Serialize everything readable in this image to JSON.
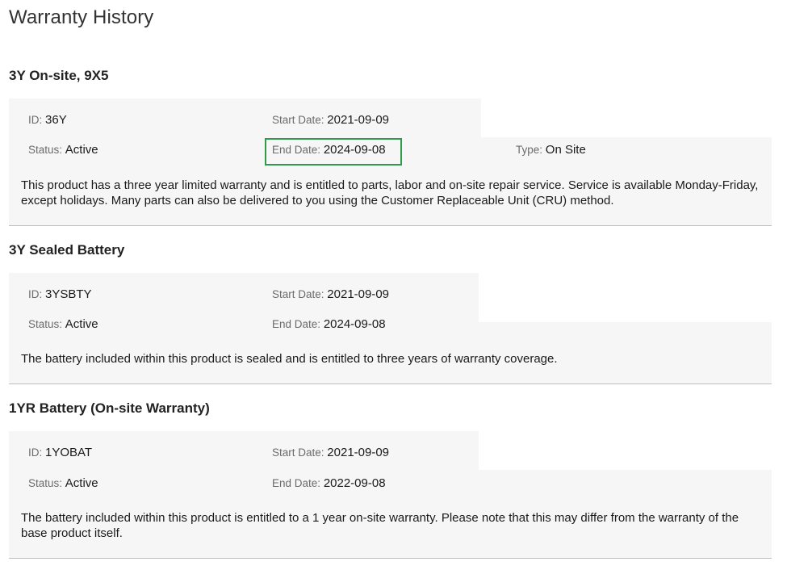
{
  "page": {
    "title": "Warranty History"
  },
  "labels": {
    "id": "ID",
    "start_date": "Start Date",
    "status": "Status",
    "end_date": "End Date",
    "type": "Type",
    "sep": ": "
  },
  "warranties": [
    {
      "title": "3Y On-site, 9X5",
      "id": "36Y",
      "start_date": "2021-09-09",
      "status": "Active",
      "end_date": "2024-09-08",
      "type": "On Site",
      "description": "This product has a three year limited warranty and is entitled to parts, labor and on-site repair service. Service is available Monday-Friday, except holidays. Many parts can also be delivered to you using the Customer Replaceable Unit (CRU) method."
    },
    {
      "title": "3Y Sealed Battery",
      "id": "3YSBTY",
      "start_date": "2021-09-09",
      "status": "Active",
      "end_date": "2024-09-08",
      "description": "The battery included within this product is sealed and is entitled to three years of warranty coverage."
    },
    {
      "title": "1YR Battery (On-site Warranty)",
      "id": "1YOBAT",
      "start_date": "2021-09-09",
      "status": "Active",
      "end_date": "2022-09-08",
      "description": "The battery included within this product is entitled to a 1 year on-site warranty. Please note that this may differ from the warranty of the base product itself."
    }
  ],
  "colors": {
    "highlight": "#2e9a4a",
    "panel_bg": "#f6f6f6",
    "label": "#6b6b6b"
  }
}
